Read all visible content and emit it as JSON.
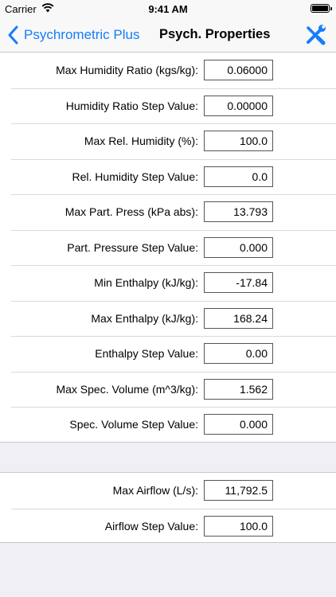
{
  "status": {
    "carrier": "Carrier",
    "time": "9:41 AM"
  },
  "nav": {
    "back_label": "Psychrometric Plus",
    "title": "Psych. Properties"
  },
  "colors": {
    "accent": "#147efb",
    "background": "#efeff4"
  },
  "group1": [
    {
      "label": "Max Humidity Ratio (kgs/kg):",
      "value": "0.06000"
    },
    {
      "label": "Humidity Ratio Step Value:",
      "value": "0.00000"
    },
    {
      "label": "Max Rel. Humidity (%):",
      "value": "100.0"
    },
    {
      "label": "Rel. Humidity Step Value:",
      "value": "0.0"
    },
    {
      "label": "Max Part. Press (kPa abs):",
      "value": "13.793"
    },
    {
      "label": "Part. Pressure Step Value:",
      "value": "0.000"
    },
    {
      "label": "Min Enthalpy (kJ/kg):",
      "value": "-17.84"
    },
    {
      "label": "Max Enthalpy (kJ/kg):",
      "value": "168.24"
    },
    {
      "label": "Enthalpy Step Value:",
      "value": "0.00"
    },
    {
      "label": "Max Spec. Volume (m^3/kg):",
      "value": "1.562"
    },
    {
      "label": "Spec. Volume Step Value:",
      "value": "0.000"
    }
  ],
  "group2": [
    {
      "label": "Max Airflow (L/s):",
      "value": "11,792.5"
    },
    {
      "label": "Airflow Step Value:",
      "value": "100.0"
    }
  ]
}
